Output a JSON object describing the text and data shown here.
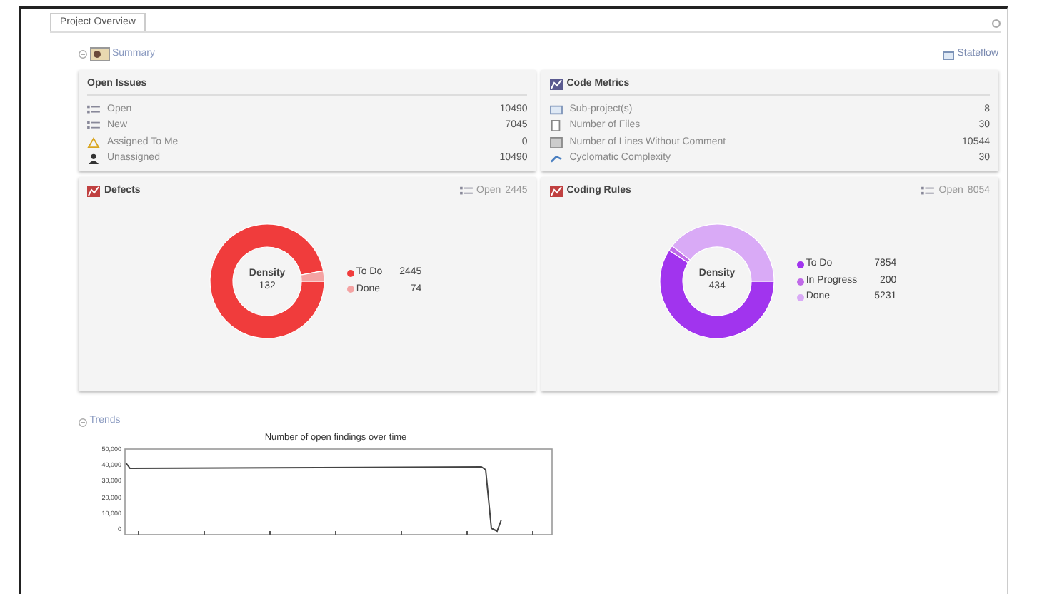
{
  "tab": {
    "label": "Project Overview",
    "selected": true
  },
  "summary": {
    "label": "Summary",
    "expanded": true
  },
  "stateflow": "Stateflow",
  "open_issues": {
    "title": "Open Issues",
    "rows": [
      {
        "kind": "open",
        "label": "Open",
        "value": "10490"
      },
      {
        "kind": "new",
        "label": "New",
        "value": "7045"
      },
      {
        "kind": "assigned",
        "label": "Assigned To Me",
        "value": "0"
      },
      {
        "kind": "unassigned",
        "label": "Unassigned",
        "value": "10490"
      }
    ]
  },
  "code_metrics": {
    "title": "Code Metrics",
    "rows": [
      {
        "kind": "folder",
        "label": "Sub-project(s)",
        "value": "8"
      },
      {
        "kind": "file",
        "label": "Number of Files",
        "value": "30"
      },
      {
        "kind": "lines",
        "label": "Number of Lines Without Comment",
        "value": "10544"
      },
      {
        "kind": "graph",
        "label": "Cyclomatic Complexity",
        "value": "30"
      }
    ]
  },
  "panels": [
    {
      "title": "Defects",
      "open_label": "Open",
      "open_value": "2445",
      "center_label": "Density",
      "center_value": "132",
      "chart_data": {
        "type": "donut",
        "categories": [
          "To Do",
          "Done"
        ],
        "values": [
          97.06,
          2.94
        ]
      },
      "legend": [
        {
          "value": "2445",
          "color": "#f03c3c"
        },
        {
          "value": "74",
          "color": "#f4a3a3"
        }
      ]
    },
    {
      "title": "Coding Rules",
      "open_label": "Open",
      "open_value": "8054",
      "center_label": "Density",
      "center_value": "434",
      "chart_data": {
        "type": "donut",
        "categories": [
          "To Do",
          "In Progress",
          "Done"
        ],
        "values": [
          59.12,
          1.51,
          39.37
        ]
      },
      "legend": [
        {
          "value": "7854",
          "color": "#a134ee"
        },
        {
          "value": "200",
          "color": "#c06ae8"
        },
        {
          "value": "5231",
          "color": "#d9aaf6"
        }
      ]
    }
  ],
  "trends": {
    "label": "Trends",
    "expanded": true,
    "chart_title": "Number of open findings over time",
    "y_axis_labels": [
      "50,000",
      "40,000",
      "30,000",
      "20,000",
      "10,000",
      "0"
    ]
  }
}
